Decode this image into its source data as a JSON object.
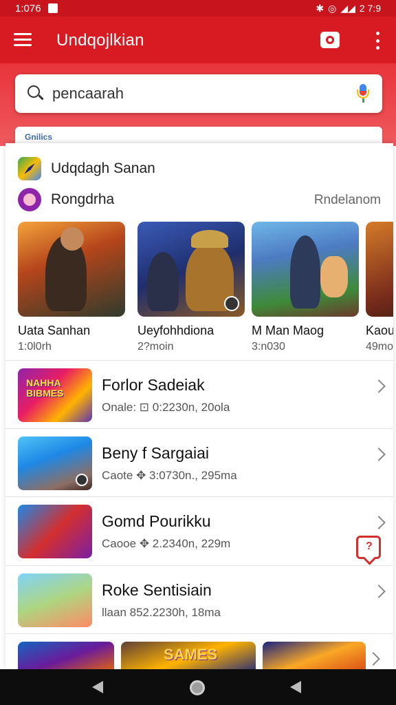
{
  "status_bar": {
    "time": "1:076",
    "right_text": "2 7:9"
  },
  "app_bar": {
    "title": "Undqojlkian"
  },
  "search": {
    "value": "pencaarah"
  },
  "tab_strip": {
    "label": "Gnilics"
  },
  "section_1": {
    "label": "Udqdagh Sanan"
  },
  "section_2": {
    "label": "Rongdrha",
    "more": "Rndelanom"
  },
  "carousel": [
    {
      "title": "Uata Sanhan",
      "subtitle": "1:0l0rh"
    },
    {
      "title": "Ueyfohhdiona",
      "subtitle": "2?moin"
    },
    {
      "title": "M Man Maog",
      "subtitle": "3:n030"
    },
    {
      "title": "Kaou",
      "subtitle": "49mo"
    }
  ],
  "list_items": [
    {
      "title": "Forlor Sadeiak",
      "subtitle": "Onale: ⊡ 0:2230n, 20ola",
      "thumb_label": "NAHHA BIBMES"
    },
    {
      "title": "Beny f Sargaiai",
      "subtitle": "Caote ✥ 3:0730n., 295ma"
    },
    {
      "title": "Gomd Pourikku",
      "subtitle": "Caooe ✥ 2.2340n, 229m"
    },
    {
      "title": "Roke Sentisiain",
      "subtitle": "llaan 852.2230h, 18ma"
    }
  ],
  "bottom_strip": {
    "banner_text": "SAMES"
  },
  "chat_fab": {
    "glyph": "?"
  },
  "colors": {
    "brand_red": "#d81b23",
    "nav_bg": "#0d0d0d"
  }
}
